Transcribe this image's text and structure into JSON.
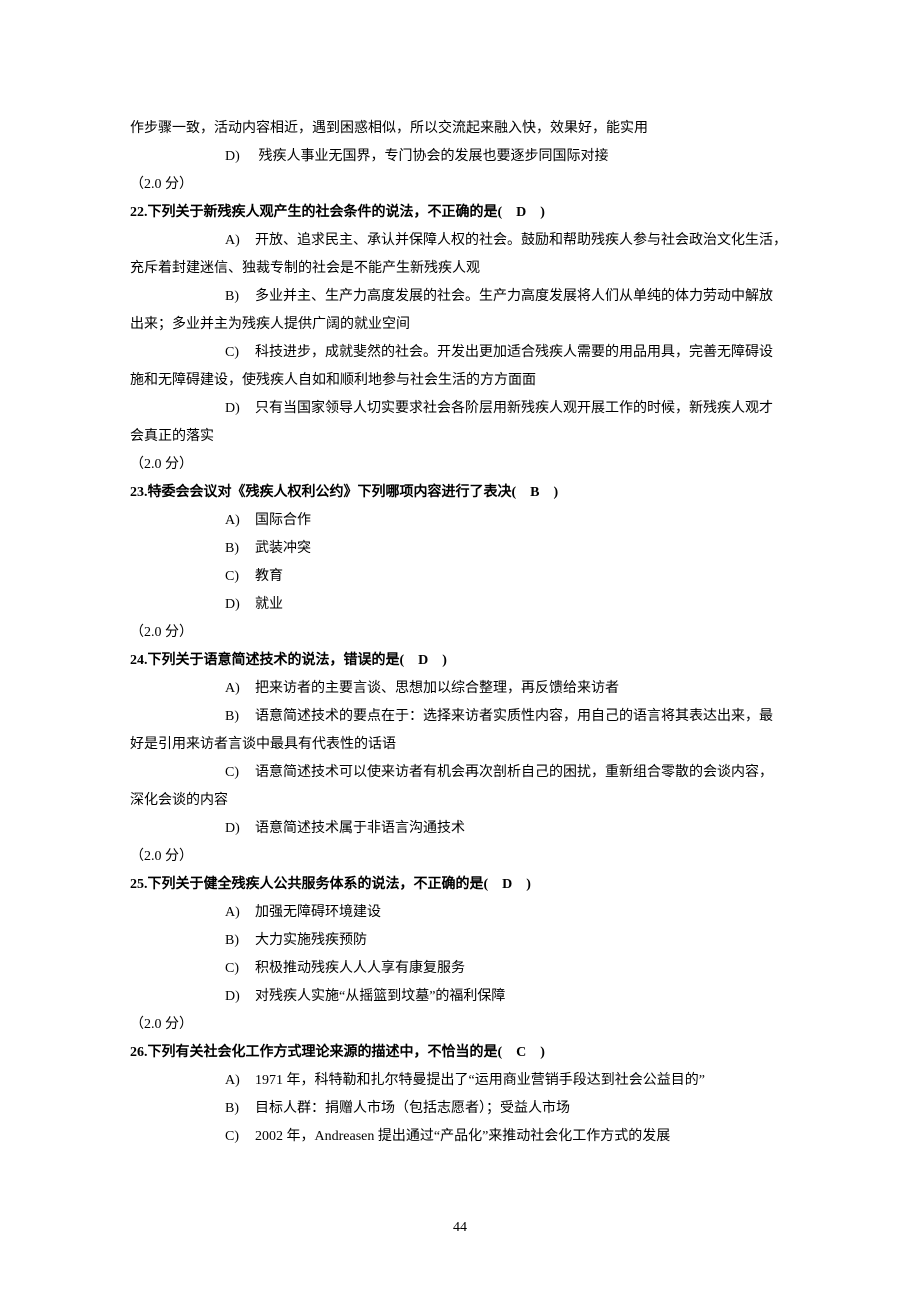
{
  "intro_continuation": "作步骤一致，活动内容相近，遇到困惑相似，所以交流起来融入快，效果好，能实用",
  "intro_option_D": {
    "label": "D)",
    "text": "残疾人事业无国界，专门协会的发展也要逐步同国际对接"
  },
  "score_text": "（2.0 分）",
  "q22": {
    "stem_prefix": "22.下列关于新残疾人观产生的社会条件的说法，不正确的是(",
    "answer": "　D　",
    "stem_suffix": ")",
    "A": {
      "label": "A)",
      "text": "开放、追求民主、承认并保障人权的社会。鼓励和帮助残疾人参与社会政治文化生活，",
      "cont": "充斥着封建迷信、独裁专制的社会是不能产生新残疾人观"
    },
    "B": {
      "label": "B)",
      "text": "多业并主、生产力高度发展的社会。生产力高度发展将人们从单纯的体力劳动中解放",
      "cont": "出来；多业并主为残疾人提供广阔的就业空间"
    },
    "C": {
      "label": "C)",
      "text": "科技进步，成就斐然的社会。开发出更加适合残疾人需要的用品用具，完善无障碍设",
      "cont": "施和无障碍建设，使残疾人自如和顺利地参与社会生活的方方面面"
    },
    "D": {
      "label": "D)",
      "text": "只有当国家领导人切实要求社会各阶层用新残疾人观开展工作的时候，新残疾人观才",
      "cont": "会真正的落实"
    }
  },
  "q23": {
    "stem_prefix": "23.特委会会议对《残疾人权利公约》下列哪项内容进行了表决(",
    "answer": "　B　",
    "stem_suffix": ")",
    "A": {
      "label": "A)",
      "text": "国际合作"
    },
    "B": {
      "label": "B)",
      "text": "武装冲突"
    },
    "C": {
      "label": "C)",
      "text": "教育"
    },
    "D": {
      "label": "D)",
      "text": "就业"
    }
  },
  "q24": {
    "stem_prefix": "24.下列关于语意简述技术的说法，错误的是(",
    "answer": "　D　",
    "stem_suffix": ")",
    "A": {
      "label": "A)",
      "text": "把来访者的主要言谈、思想加以综合整理，再反馈给来访者"
    },
    "B": {
      "label": "B)",
      "text": "语意简述技术的要点在于：选择来访者实质性内容，用自己的语言将其表达出来，最",
      "cont": "好是引用来访者言谈中最具有代表性的话语"
    },
    "C": {
      "label": "C)",
      "text": "语意简述技术可以使来访者有机会再次剖析自己的困扰，重新组合零散的会谈内容，",
      "cont": "深化会谈的内容"
    },
    "D": {
      "label": "D)",
      "text": "语意简述技术属于非语言沟通技术"
    }
  },
  "q25": {
    "stem_prefix": "25.下列关于健全残疾人公共服务体系的说法，不正确的是(",
    "answer": "　D　",
    "stem_suffix": ")",
    "A": {
      "label": "A)",
      "text": "加强无障碍环境建设"
    },
    "B": {
      "label": "B)",
      "text": "大力实施残疾预防"
    },
    "C": {
      "label": "C)",
      "text": "积极推动残疾人人人享有康复服务"
    },
    "D": {
      "label": "D)",
      "text": "对残疾人实施“从摇篮到坟墓”的福利保障"
    }
  },
  "q26": {
    "stem_prefix": "26.下列有关社会化工作方式理论来源的描述中，不恰当的是(",
    "answer": "　C　",
    "stem_suffix": ")",
    "A": {
      "label": "A)",
      "text": "1971 年，科特勒和扎尔特曼提出了“运用商业营销手段达到社会公益目的”"
    },
    "B": {
      "label": "B)",
      "text": "目标人群：捐赠人市场（包括志愿者）；受益人市场"
    },
    "C": {
      "label": "C)",
      "text": "2002 年，Andreasen 提出通过“产品化”来推动社会化工作方式的发展"
    }
  },
  "page_number": "44"
}
